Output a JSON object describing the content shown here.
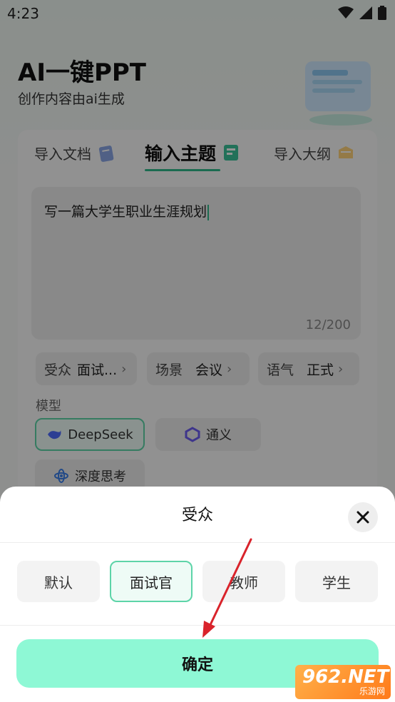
{
  "status_bar": {
    "time": "4:23"
  },
  "header": {
    "title": "AI一键PPT",
    "subtitle": "创作内容由ai生成"
  },
  "tabs": [
    {
      "label": "导入文档",
      "icon": "document-icon"
    },
    {
      "label": "输入主题",
      "icon": "topic-icon",
      "active": true
    },
    {
      "label": "导入大纲",
      "icon": "outline-icon"
    }
  ],
  "editor": {
    "text": "写一篇大学生职业生涯规划",
    "counter": "12/200"
  },
  "options": [
    {
      "label": "受众",
      "value": "面试..."
    },
    {
      "label": "场景",
      "value": "会议"
    },
    {
      "label": "语气",
      "value": "正式"
    }
  ],
  "model": {
    "label": "模型",
    "items": [
      {
        "label": "DeepSeek",
        "selected": true
      },
      {
        "label": "通义"
      },
      {
        "label": "深度思考"
      }
    ]
  },
  "sheet": {
    "title": "受众",
    "choices": [
      "默认",
      "面试官",
      "教师",
      "学生"
    ],
    "selected": "面试官",
    "confirm_label": "确定"
  },
  "watermark": {
    "brand": "962.NET",
    "caption": "乐游网"
  },
  "colors": {
    "accent": "#2fb88a",
    "confirm": "#8ef8d5",
    "selected_border": "#5dd4a8",
    "arrow": "#d9232b"
  }
}
